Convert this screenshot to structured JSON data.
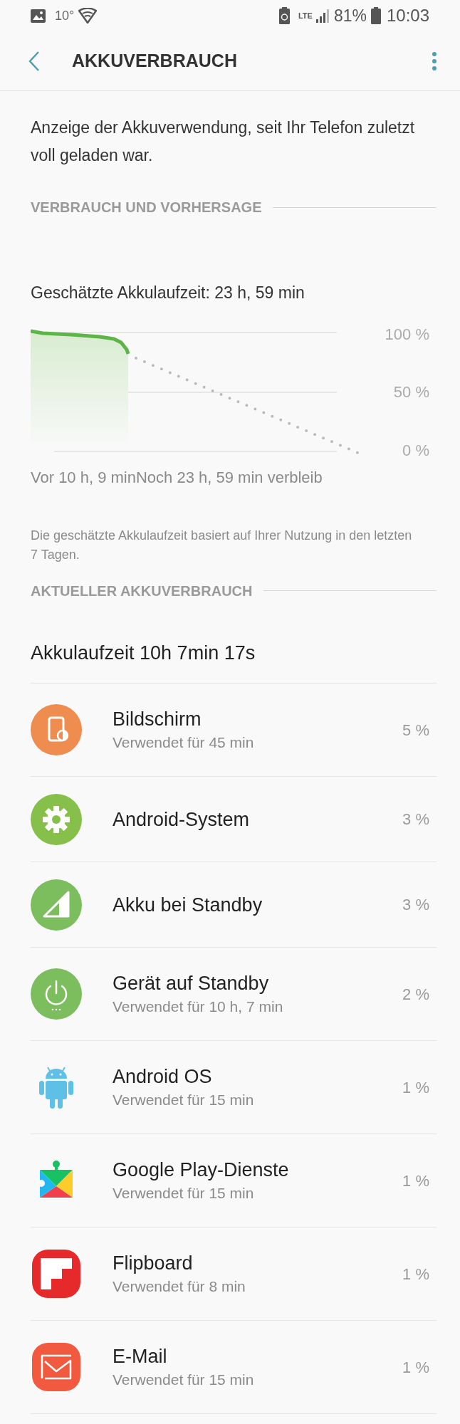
{
  "status_bar": {
    "temperature": "10°",
    "network": "LTE",
    "battery": "81%",
    "time": "10:03"
  },
  "header": {
    "title": "AKKUVERBRAUCH"
  },
  "intro": "Anzeige der Akkuverwendung, seit Ihr Telefon zuletzt voll geladen war.",
  "forecast_section": {
    "heading": "VERBRAUCH UND VORHERSAGE",
    "estimate": "Geschätzte Akkulaufzeit: 23 h, 59 min",
    "y_labels": [
      "100 %",
      "50 %",
      "0 %"
    ],
    "x_labels": [
      "Vor 10 h, 9 min",
      "Noch 23 h, 59 min verbleib"
    ],
    "note": "Die geschätzte Akkulaufzeit basiert auf Ihrer Nutzung in den letzten 7 Tagen."
  },
  "usage_section": {
    "heading": "AKTUELLER AKKUVERBRAUCH",
    "runtime": "Akkulaufzeit 10h 7min 17s",
    "apps": [
      {
        "kind": "screen",
        "name": "Bildschirm",
        "detail": "Verwendet für 45 min",
        "percent": "5 %"
      },
      {
        "kind": "gear",
        "name": "Android-System",
        "percent": "3 %"
      },
      {
        "kind": "signal",
        "name": "Akku bei Standby",
        "percent": "3 %"
      },
      {
        "kind": "power",
        "name": "Gerät auf Standby",
        "detail": "Verwendet für 10 h, 7 min",
        "percent": "2 %"
      },
      {
        "kind": "android",
        "name": "Android OS",
        "detail": "Verwendet für 15 min",
        "percent": "1 %"
      },
      {
        "kind": "puzzle",
        "name": "Google Play-Dienste",
        "detail": "Verwendet für 15 min",
        "percent": "1 %"
      },
      {
        "kind": "flipboard",
        "name": "Flipboard",
        "detail": "Verwendet für 8 min",
        "percent": "1 %"
      },
      {
        "kind": "mail",
        "name": "E-Mail",
        "detail": "Verwendet für 15 min",
        "percent": "1 %"
      }
    ]
  }
}
